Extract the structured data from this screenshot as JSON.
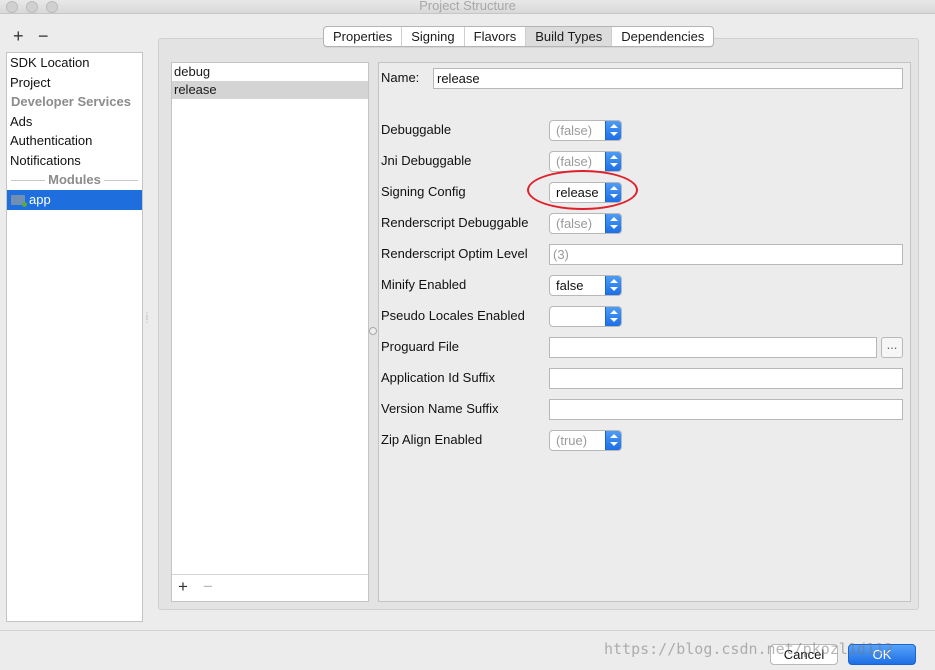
{
  "window": {
    "title": "Project Structure"
  },
  "toolbar": {
    "add_label": "+",
    "remove_label": "−"
  },
  "sidebar": {
    "items": [
      {
        "label": "SDK Location"
      },
      {
        "label": "Project"
      },
      {
        "label": "Developer Services"
      },
      {
        "label": "Ads"
      },
      {
        "label": "Authentication"
      },
      {
        "label": "Notifications"
      }
    ],
    "modules_header": "Modules",
    "module": "app"
  },
  "tabs": [
    {
      "label": "Properties"
    },
    {
      "label": "Signing"
    },
    {
      "label": "Flavors"
    },
    {
      "label": "Build Types",
      "active": true
    },
    {
      "label": "Dependencies"
    }
  ],
  "build_types": {
    "items": [
      "debug",
      "release"
    ],
    "selected": "release",
    "add_label": "+",
    "remove_label": "−"
  },
  "form": {
    "name_label": "Name:",
    "name_value": "release",
    "debuggable": {
      "label": "Debuggable",
      "value": "(false)"
    },
    "jni_debuggable": {
      "label": "Jni Debuggable",
      "value": "(false)"
    },
    "signing_config": {
      "label": "Signing Config",
      "value": "release"
    },
    "renderscript_debuggable": {
      "label": "Renderscript Debuggable",
      "value": "(false)"
    },
    "renderscript_optim_level": {
      "label": "Renderscript Optim Level",
      "value": "(3)"
    },
    "minify_enabled": {
      "label": "Minify Enabled",
      "value": "false"
    },
    "pseudo_locales_enabled": {
      "label": "Pseudo Locales Enabled",
      "value": ""
    },
    "proguard_file": {
      "label": "Proguard File",
      "value": "",
      "browse_label": "..."
    },
    "application_id_suffix": {
      "label": "Application Id Suffix",
      "value": ""
    },
    "version_name_suffix": {
      "label": "Version Name Suffix",
      "value": ""
    },
    "zip_align_enabled": {
      "label": "Zip Align Enabled",
      "value": "(true)"
    }
  },
  "footer": {
    "cancel_label": "Cancel",
    "ok_label": "OK"
  },
  "watermark": "https://blog.csdn.net/pkozl1d112",
  "colors": {
    "accent": "#1e6fdd",
    "annotation": "#e0202b"
  }
}
